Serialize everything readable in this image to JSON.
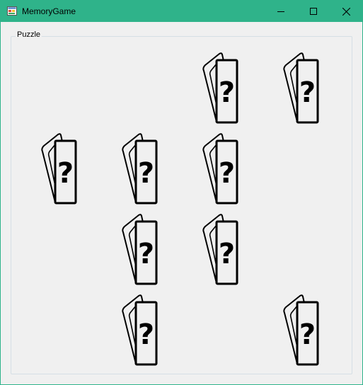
{
  "window": {
    "title": "MemoryGame",
    "accent_color": "#2fb38a",
    "controls": [
      {
        "name": "minimize",
        "icon": "minimize-icon"
      },
      {
        "name": "maximize",
        "icon": "maximize-icon"
      },
      {
        "name": "close",
        "icon": "close-icon"
      }
    ]
  },
  "puzzle": {
    "group_label": "Puzzle",
    "card_face": "?",
    "grid": {
      "rows": 4,
      "cols": 4,
      "cards": [
        {
          "row": 0,
          "col": 2,
          "state": "face-down"
        },
        {
          "row": 0,
          "col": 3,
          "state": "face-down"
        },
        {
          "row": 1,
          "col": 0,
          "state": "face-down"
        },
        {
          "row": 1,
          "col": 1,
          "state": "face-down"
        },
        {
          "row": 1,
          "col": 2,
          "state": "face-down"
        },
        {
          "row": 2,
          "col": 1,
          "state": "face-down"
        },
        {
          "row": 2,
          "col": 2,
          "state": "face-down"
        },
        {
          "row": 3,
          "col": 1,
          "state": "face-down"
        },
        {
          "row": 3,
          "col": 3,
          "state": "face-down"
        }
      ]
    }
  }
}
